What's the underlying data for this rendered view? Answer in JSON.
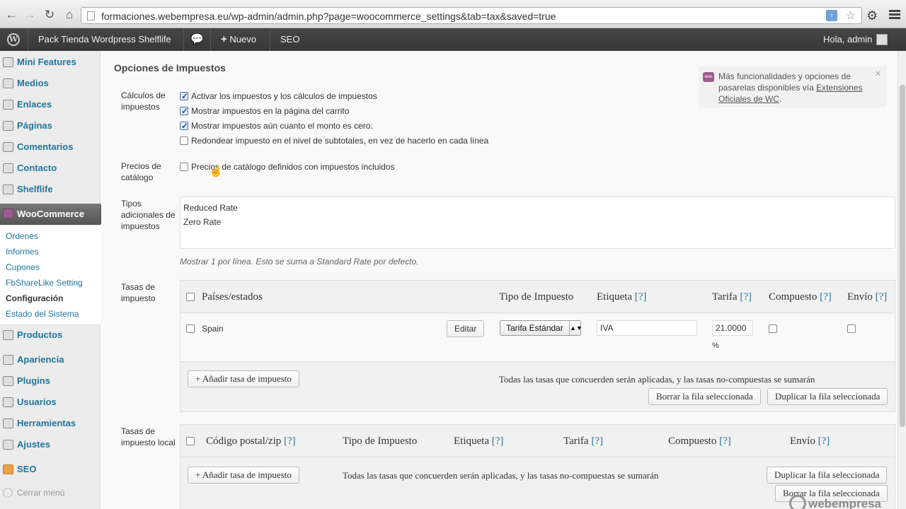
{
  "browser": {
    "url": "formaciones.webempresa.eu/wp-admin/admin.php?page=woocommerce_settings&tab=tax&saved=true"
  },
  "adminbar": {
    "site_name": "Pack Tienda Wordpress Shelflife",
    "new_label": "Nuevo",
    "seo_label": "SEO",
    "greeting": "Hola, admin"
  },
  "sidebar": {
    "items": [
      {
        "label": "Mini Features"
      },
      {
        "label": "Medios"
      },
      {
        "label": "Enlaces"
      },
      {
        "label": "Páginas"
      },
      {
        "label": "Comentarios"
      },
      {
        "label": "Contacto"
      },
      {
        "label": "Shelflife"
      },
      {
        "label": "WooCommerce"
      },
      {
        "label": "Productos"
      },
      {
        "label": "Apariencia"
      },
      {
        "label": "Plugins"
      },
      {
        "label": "Usuarios"
      },
      {
        "label": "Herramientas"
      },
      {
        "label": "Ajustes"
      },
      {
        "label": "SEO"
      }
    ],
    "submenu": [
      {
        "label": "Ordenes"
      },
      {
        "label": "Informes"
      },
      {
        "label": "Cupones"
      },
      {
        "label": "FbShareLike Setting"
      },
      {
        "label": "Configuración"
      },
      {
        "label": "Estado del Sistema"
      }
    ],
    "collapse_label": "Cerrar menú"
  },
  "main": {
    "section_title": "Opciones de Impuestos",
    "calc_label": "Cálculos de impuestos",
    "calc_options": [
      {
        "label": "Activar los impuestos y los cálculos de impuestos",
        "checked": true
      },
      {
        "label": "Mostrar impuestos en la página del carrito",
        "checked": true
      },
      {
        "label": "Mostrar impuestos aún cuanto el monto es cero.",
        "checked": true
      },
      {
        "label": "Redondear impuesto en el nivel de subtotales, en vez de hacerlo en cada línea",
        "checked": false
      }
    ],
    "catalog_label": "Precios de catálogo",
    "catalog_option": {
      "label": "Precios de catálogo definidos con impuestos incluidos",
      "checked": false
    },
    "additional_label": "Tipos adicionales de impuestos",
    "additional_lines": [
      "Reduced Rate",
      "Zero Rate"
    ],
    "additional_desc": "Mostrar 1 por línea. Esto se suma a Standard Rate por defecto.",
    "rates_label": "Tasas de impuesto",
    "rates_table": {
      "headers": {
        "countries": "Países/estados",
        "type": "Tipo de Impuesto",
        "label": "Etiqueta",
        "rate": "Tarifa",
        "compound": "Compuesto",
        "shipping": "Envío",
        "help": "[?]"
      },
      "row": {
        "country": "Spain",
        "edit_button": "Editar",
        "type": "Tarifa Estándar",
        "label": "IVA",
        "rate": "21.0000",
        "percent": "%"
      },
      "add_button": "+ Añadir tasa de impuesto",
      "note": "Todas las tasas que concuerden serán aplicadas, y las tasas no-compuestas se sumarán",
      "delete_button": "Borrar la fila seleccionada",
      "duplicate_button": "Duplicar la fila seleccionada"
    },
    "local_label": "Tasas de impuesto local",
    "local_table": {
      "headers": {
        "zip": "Código postal/zip",
        "type": "Tipo de Impuesto",
        "label": "Etiqueta",
        "rate": "Tarifa",
        "compound": "Compuesto",
        "shipping": "Envío",
        "help": "[?]"
      },
      "add_button": "+ Añadir tasa de impuesto",
      "note": "Todas las tasas que concuerden serán aplicadas, y las tasas no-compuestas se sumarán",
      "duplicate_button": "Duplicar la fila seleccionada",
      "delete_button": "Borrar la fila seleccionada"
    },
    "notice": {
      "text": "Más funcionalidades y opciones de pasarelas disponibles vía",
      "link": "Extensiones Oficiales de WC",
      "suffix": "."
    }
  },
  "watermark": "webempresa"
}
